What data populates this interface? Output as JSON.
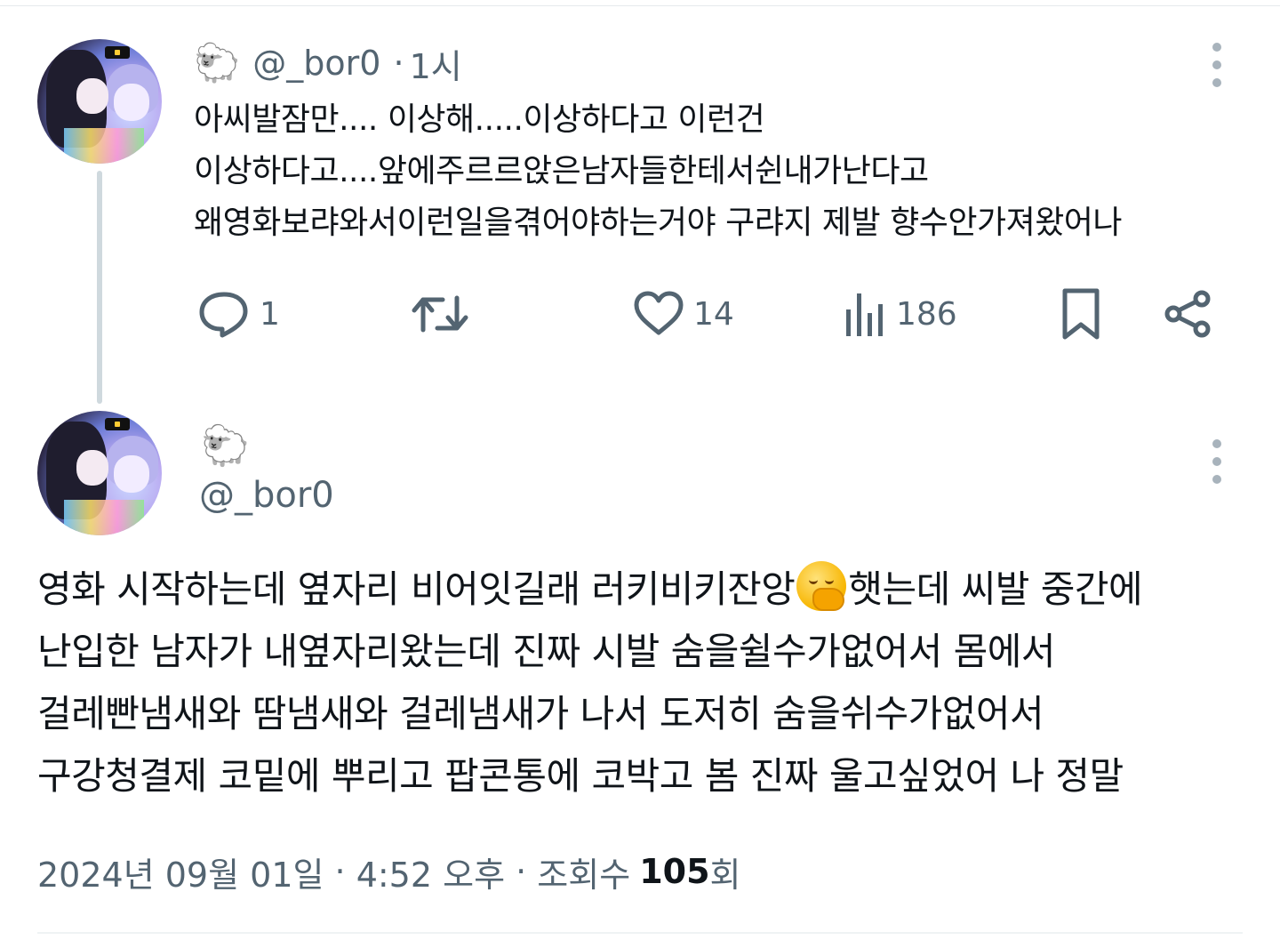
{
  "reply": {
    "emoji": "🐑",
    "handle": "@_bor0",
    "separator": "·",
    "time": "1시",
    "lines": [
      "아씨발잠만.... 이상해.....이상하다고 이런건",
      "이상하다고....앞에주르르앉은남자들한테서쉰내가난다고",
      "왜영화보랴와서이런일을겪어야하는거야 구랴지 제발 향수안가져왔어나"
    ],
    "actions": {
      "reply_count": "1",
      "retweet_count": "",
      "like_count": "14",
      "views_count": "186"
    }
  },
  "main": {
    "emoji": "🐑",
    "handle": "@_bor0",
    "lines": [
      {
        "before": "영화 시작하는데 옆자리 비어잇길래 러키비키잔앙",
        "emoji": "face-with-hand-over-mouth",
        "after": "햇는데 씨발 중간에"
      },
      {
        "text": "난입한 남자가 내옆자리왔는데 진짜 시발 숨을쉴수가없어서 몸에서"
      },
      {
        "text": "걸레빤냄새와 땀냄새와 걸레냄새가 나서 도저히 숨을쉬수가없어서"
      },
      {
        "text": "구강청결제 코밑에 뿌리고 팝콘통에 코박고 봄 진짜 울고싶었어 나 정말"
      }
    ],
    "meta": {
      "date": "2024년 09월 01일",
      "sep1": " · ",
      "time": "4:52 오후",
      "sep2": " · ",
      "views_label": "조회수",
      "views_count": "105",
      "views_unit": "회"
    }
  },
  "icons": {
    "reply": "reply-bubble-icon",
    "retweet": "retweet-icon",
    "like": "heart-icon",
    "views": "bar-chart-icon",
    "bookmark": "bookmark-icon",
    "share": "share-icon",
    "more": "more-vertical-icon"
  },
  "colors": {
    "text": "#0f1419",
    "muted": "#536471",
    "thread_line": "#cfd9de",
    "divider": "#eff3f4"
  }
}
